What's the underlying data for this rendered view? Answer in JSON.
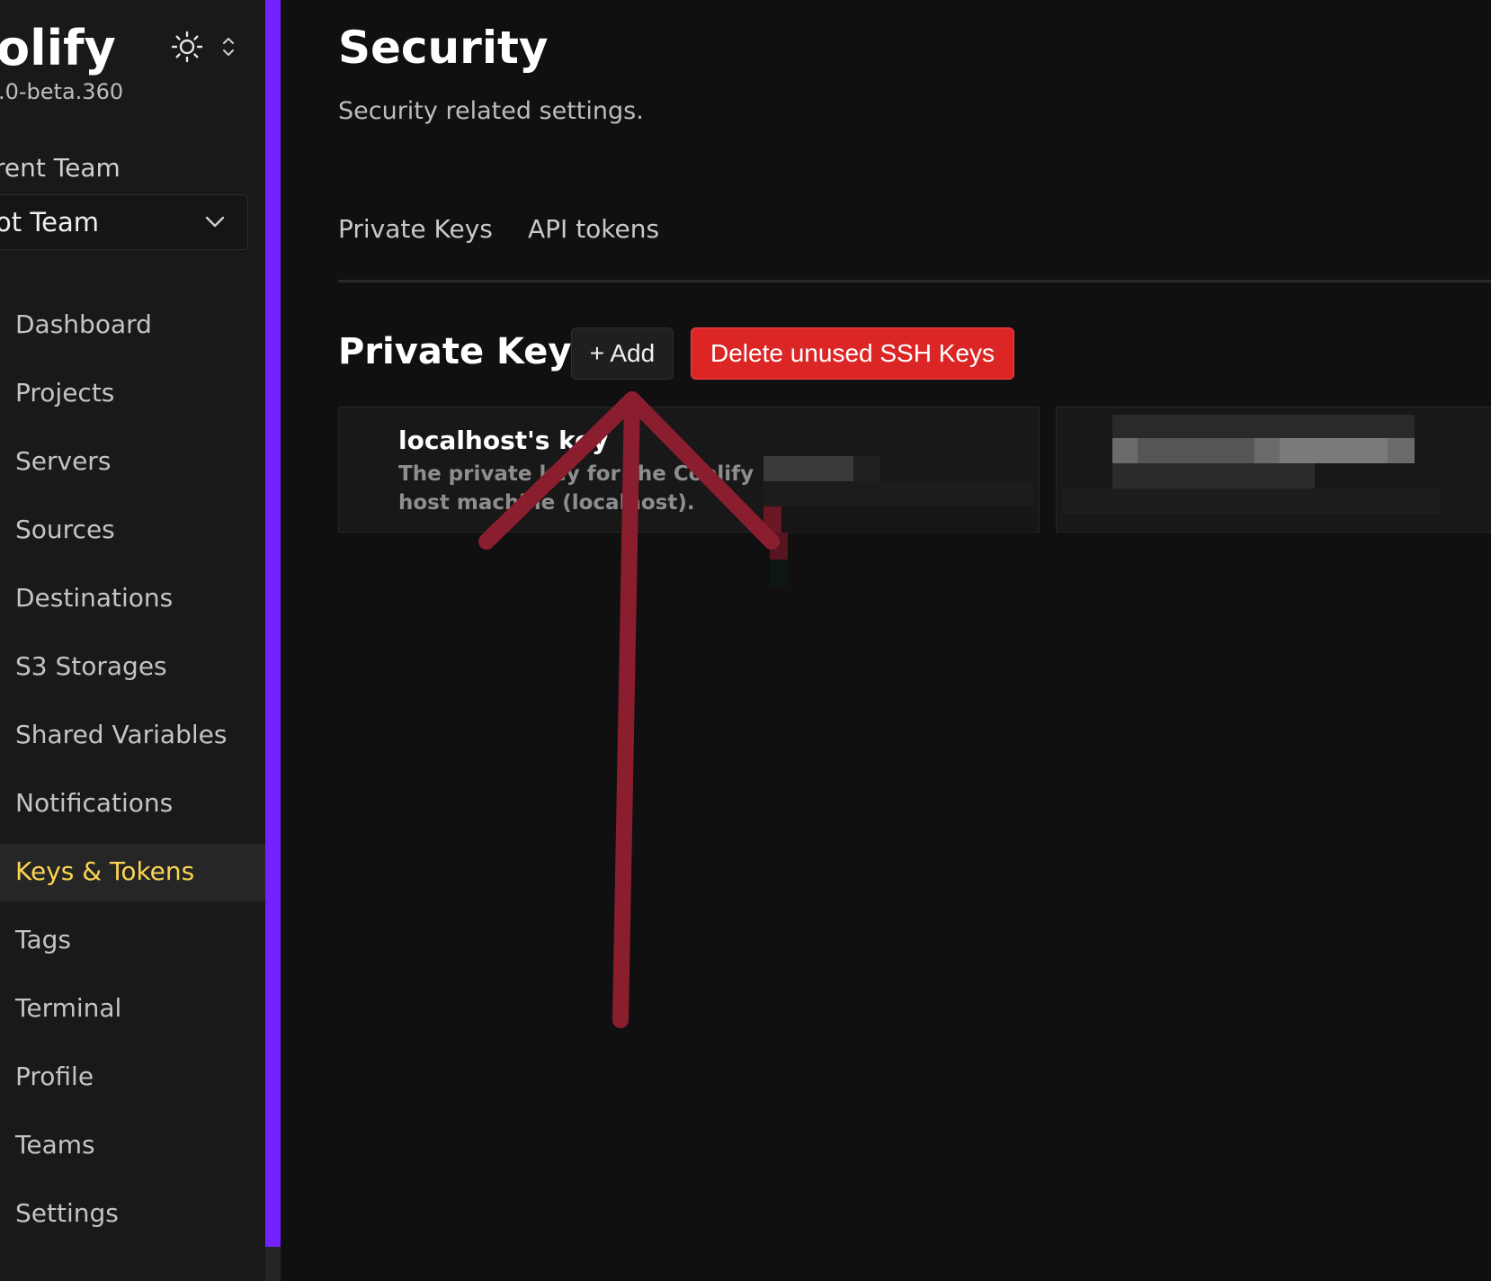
{
  "sidebar": {
    "brand": "olify",
    "version": ".0-beta.360",
    "team_label": "rent Team",
    "team_select_value": "ot Team",
    "items": [
      {
        "label": "Dashboard"
      },
      {
        "label": "Projects"
      },
      {
        "label": "Servers"
      },
      {
        "label": "Sources"
      },
      {
        "label": "Destinations"
      },
      {
        "label": "S3 Storages"
      },
      {
        "label": "Shared Variables"
      },
      {
        "label": "Notifications"
      },
      {
        "label": "Keys & Tokens"
      },
      {
        "label": "Tags"
      },
      {
        "label": "Terminal"
      },
      {
        "label": "Profile"
      },
      {
        "label": "Teams"
      },
      {
        "label": "Settings"
      }
    ],
    "active_item": "Keys & Tokens"
  },
  "page": {
    "title": "Security",
    "subtitle": "Security related settings.",
    "tabs": [
      {
        "label": "Private Keys"
      },
      {
        "label": "API tokens"
      }
    ]
  },
  "private_keys": {
    "section_title": "Private Keys",
    "add_label": "+ Add",
    "delete_label": "Delete unused SSH Keys",
    "cards": [
      {
        "title": "localhost's key",
        "description": "The private key for the Coolify host machine (localhost)."
      }
    ]
  },
  "colors": {
    "accent": "#7322ff",
    "active_nav": "#fcd452",
    "danger": "#dc2626",
    "annotation_arrow": "#8b1e2e"
  },
  "icons": {
    "theme": "sun-icon",
    "theme_switch": "chevron-up-down-icon",
    "team_dropdown": "chevron-down-icon"
  }
}
